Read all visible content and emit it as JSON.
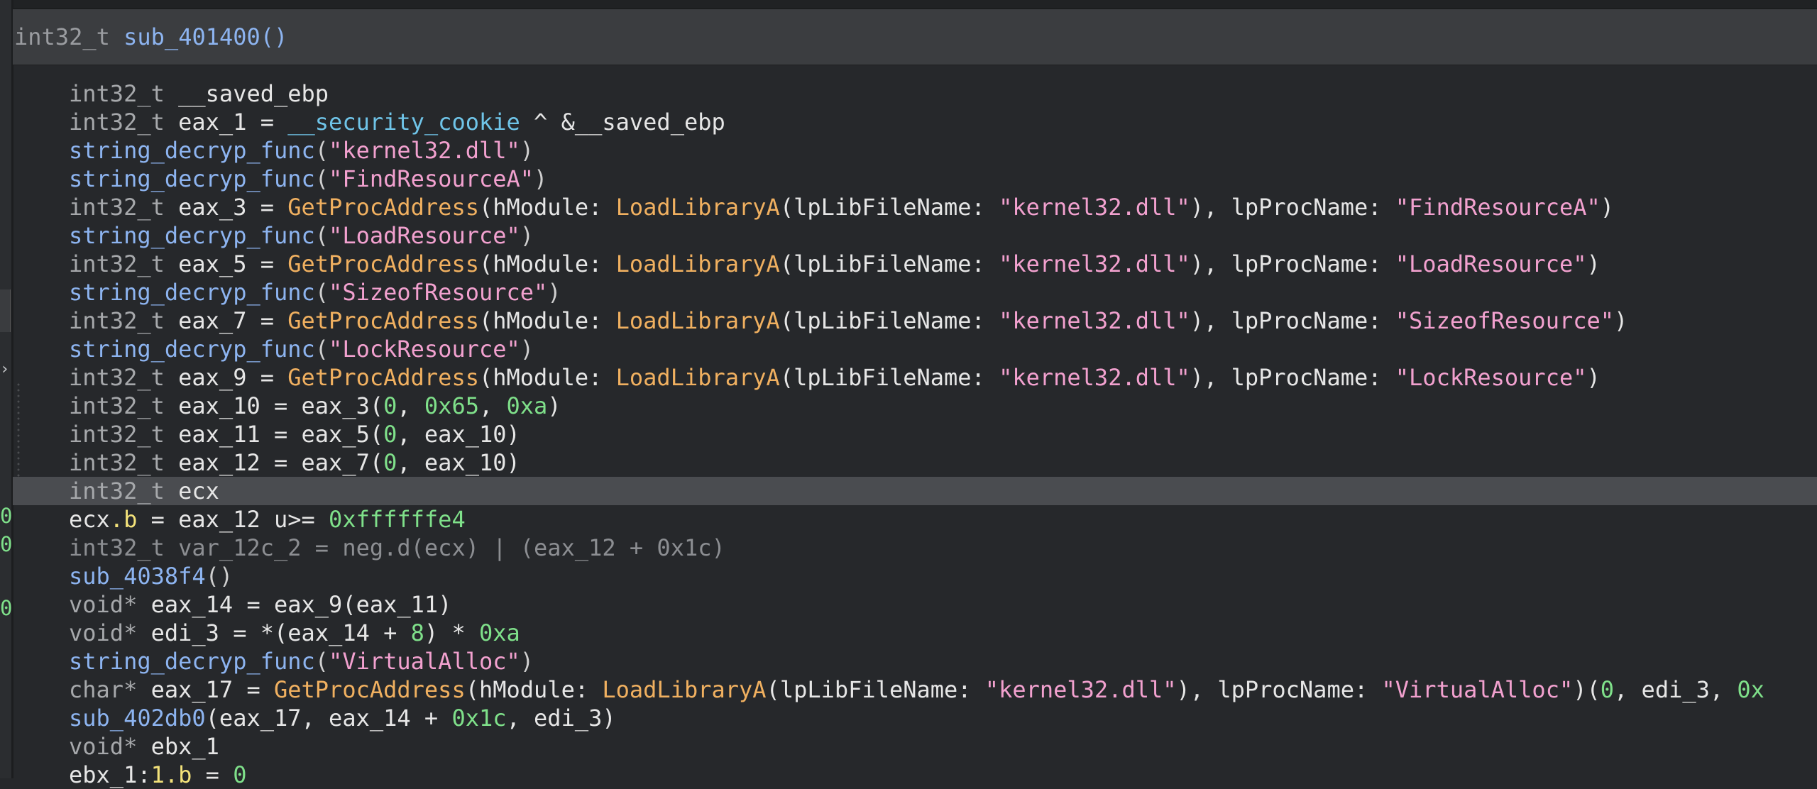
{
  "header": {
    "return_type": "int32_t",
    "function_name": "sub_401400()"
  },
  "left_pane": {
    "arrow": "›",
    "digits": [
      "0",
      "0",
      "0"
    ]
  },
  "code_lines": [
    [
      [
        "t",
        "int32_t"
      ],
      [
        "v",
        " __saved_ebp"
      ]
    ],
    [
      [
        "t",
        "int32_t"
      ],
      [
        "v",
        " eax_1 = "
      ],
      [
        "g",
        "__security_cookie"
      ],
      [
        "v",
        " ^ &__saved_ebp"
      ]
    ],
    [
      [
        "f",
        "string_decryp_func"
      ],
      [
        "p",
        "("
      ],
      [
        "s",
        "\"kernel32.dll\""
      ],
      [
        "p",
        ")"
      ]
    ],
    [
      [
        "f",
        "string_decryp_func"
      ],
      [
        "p",
        "("
      ],
      [
        "s",
        "\"FindResourceA\""
      ],
      [
        "p",
        ")"
      ]
    ],
    [
      [
        "t",
        "int32_t"
      ],
      [
        "v",
        " eax_3 = "
      ],
      [
        "a",
        "GetProcAddress"
      ],
      [
        "v",
        "(hModule: "
      ],
      [
        "a",
        "LoadLibraryA"
      ],
      [
        "v",
        "(lpLibFileName: "
      ],
      [
        "s",
        "\"kernel32.dll\""
      ],
      [
        "v",
        "), lpProcName: "
      ],
      [
        "s",
        "\"FindResourceA\""
      ],
      [
        "v",
        ")"
      ]
    ],
    [
      [
        "f",
        "string_decryp_func"
      ],
      [
        "p",
        "("
      ],
      [
        "s",
        "\"LoadResource\""
      ],
      [
        "p",
        ")"
      ]
    ],
    [
      [
        "t",
        "int32_t"
      ],
      [
        "v",
        " eax_5 = "
      ],
      [
        "a",
        "GetProcAddress"
      ],
      [
        "v",
        "(hModule: "
      ],
      [
        "a",
        "LoadLibraryA"
      ],
      [
        "v",
        "(lpLibFileName: "
      ],
      [
        "s",
        "\"kernel32.dll\""
      ],
      [
        "v",
        "), lpProcName: "
      ],
      [
        "s",
        "\"LoadResource\""
      ],
      [
        "v",
        ")"
      ]
    ],
    [
      [
        "f",
        "string_decryp_func"
      ],
      [
        "p",
        "("
      ],
      [
        "s",
        "\"SizeofResource\""
      ],
      [
        "p",
        ")"
      ]
    ],
    [
      [
        "t",
        "int32_t"
      ],
      [
        "v",
        " eax_7 = "
      ],
      [
        "a",
        "GetProcAddress"
      ],
      [
        "v",
        "(hModule: "
      ],
      [
        "a",
        "LoadLibraryA"
      ],
      [
        "v",
        "(lpLibFileName: "
      ],
      [
        "s",
        "\"kernel32.dll\""
      ],
      [
        "v",
        "), lpProcName: "
      ],
      [
        "s",
        "\"SizeofResource\""
      ],
      [
        "v",
        ")"
      ]
    ],
    [
      [
        "f",
        "string_decryp_func"
      ],
      [
        "p",
        "("
      ],
      [
        "s",
        "\"LockResource\""
      ],
      [
        "p",
        ")"
      ]
    ],
    [
      [
        "t",
        "int32_t"
      ],
      [
        "v",
        " eax_9 = "
      ],
      [
        "a",
        "GetProcAddress"
      ],
      [
        "v",
        "(hModule: "
      ],
      [
        "a",
        "LoadLibraryA"
      ],
      [
        "v",
        "(lpLibFileName: "
      ],
      [
        "s",
        "\"kernel32.dll\""
      ],
      [
        "v",
        "), lpProcName: "
      ],
      [
        "s",
        "\"LockResource\""
      ],
      [
        "v",
        ")"
      ]
    ],
    [
      [
        "t",
        "int32_t"
      ],
      [
        "v",
        " eax_10 = eax_3("
      ],
      [
        "n",
        "0"
      ],
      [
        "v",
        ", "
      ],
      [
        "n",
        "0x65"
      ],
      [
        "v",
        ", "
      ],
      [
        "n",
        "0xa"
      ],
      [
        "v",
        ")"
      ]
    ],
    [
      [
        "t",
        "int32_t"
      ],
      [
        "v",
        " eax_11 = eax_5("
      ],
      [
        "n",
        "0"
      ],
      [
        "v",
        ", eax_10)"
      ]
    ],
    [
      [
        "t",
        "int32_t"
      ],
      [
        "v",
        " eax_12 = eax_7("
      ],
      [
        "n",
        "0"
      ],
      [
        "v",
        ", eax_10)"
      ]
    ],
    [
      [
        "t",
        "int32_t"
      ],
      [
        "v",
        " ecx"
      ]
    ],
    [
      [
        "v",
        "ecx"
      ],
      [
        "y",
        ".b"
      ],
      [
        "v",
        " = eax_12 u>= "
      ],
      [
        "n",
        "0xffffffe4"
      ]
    ],
    [
      [
        "d",
        "int32_t var_12c_2 = neg.d(ecx) | (eax_12 + 0x1c)"
      ]
    ],
    [
      [
        "f",
        "sub_4038f4"
      ],
      [
        "p",
        "()"
      ]
    ],
    [
      [
        "t",
        "void*"
      ],
      [
        "v",
        " eax_14 = eax_9(eax_11)"
      ]
    ],
    [
      [
        "t",
        "void*"
      ],
      [
        "v",
        " edi_3 = *(eax_14 + "
      ],
      [
        "n",
        "8"
      ],
      [
        "v",
        ") * "
      ],
      [
        "n",
        "0xa"
      ]
    ],
    [
      [
        "f",
        "string_decryp_func"
      ],
      [
        "p",
        "("
      ],
      [
        "s",
        "\"VirtualAlloc\""
      ],
      [
        "p",
        ")"
      ]
    ],
    [
      [
        "t",
        "char*"
      ],
      [
        "v",
        " eax_17 = "
      ],
      [
        "a",
        "GetProcAddress"
      ],
      [
        "v",
        "(hModule: "
      ],
      [
        "a",
        "LoadLibraryA"
      ],
      [
        "v",
        "(lpLibFileName: "
      ],
      [
        "s",
        "\"kernel32.dll\""
      ],
      [
        "v",
        "), lpProcName: "
      ],
      [
        "s",
        "\"VirtualAlloc\""
      ],
      [
        "v",
        ")("
      ],
      [
        "n",
        "0"
      ],
      [
        "v",
        ", edi_3, "
      ],
      [
        "n",
        "0x"
      ]
    ],
    [
      [
        "f",
        "sub_402db0"
      ],
      [
        "v",
        "(eax_17, eax_14 + "
      ],
      [
        "n",
        "0x1c"
      ],
      [
        "v",
        ", edi_3)"
      ]
    ],
    [
      [
        "t",
        "void*"
      ],
      [
        "v",
        " ebx_1"
      ]
    ],
    [
      [
        "v",
        "ebx_1:"
      ],
      [
        "y",
        "1.b"
      ],
      [
        "v",
        " = "
      ],
      [
        "n",
        "0"
      ]
    ]
  ],
  "highlighted_line": 14,
  "colors": {
    "background": "#26282b",
    "header_bg": "#3b3d40",
    "highlight_bg": "#4a4c50",
    "type": "#a6a8ab",
    "function": "#8db4f0",
    "string": "#f2a1cf",
    "api": "#f0b060",
    "number": "#7fe08a",
    "global": "#6fc4e8"
  }
}
